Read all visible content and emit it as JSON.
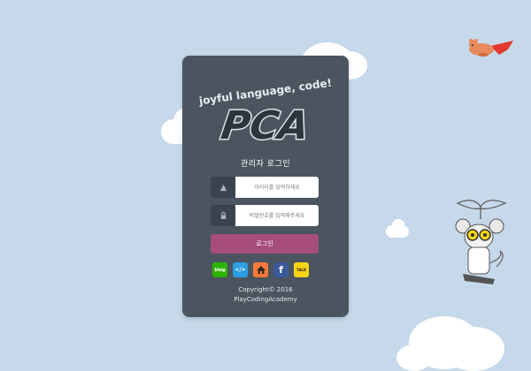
{
  "brand": {
    "tagline": "joyful language, code!",
    "logo_text": "PCA"
  },
  "login": {
    "title": "관리자 로그인",
    "id_placeholder": "아이디를 입력하세요",
    "pw_placeholder": "비밀번호를 입력해주세요",
    "button_label": "로그인"
  },
  "social": {
    "items": [
      {
        "name": "blog-icon",
        "label": "blog",
        "color": "#2db400"
      },
      {
        "name": "code-icon",
        "label": "</>",
        "color": "#2a9ee0"
      },
      {
        "name": "home-icon",
        "label": "home",
        "color": "#ff7a3a"
      },
      {
        "name": "facebook-icon",
        "label": "f",
        "color": "#3b5998"
      },
      {
        "name": "kakaotalk-icon",
        "label": "TALK",
        "color": "#f7d515"
      }
    ]
  },
  "footer": {
    "copyright": "Copyright© 2016",
    "org": "PlayCodingAcademy"
  },
  "colors": {
    "background": "#c6d9ea",
    "panel": "#4a5560",
    "accent": "#a64d7d"
  }
}
